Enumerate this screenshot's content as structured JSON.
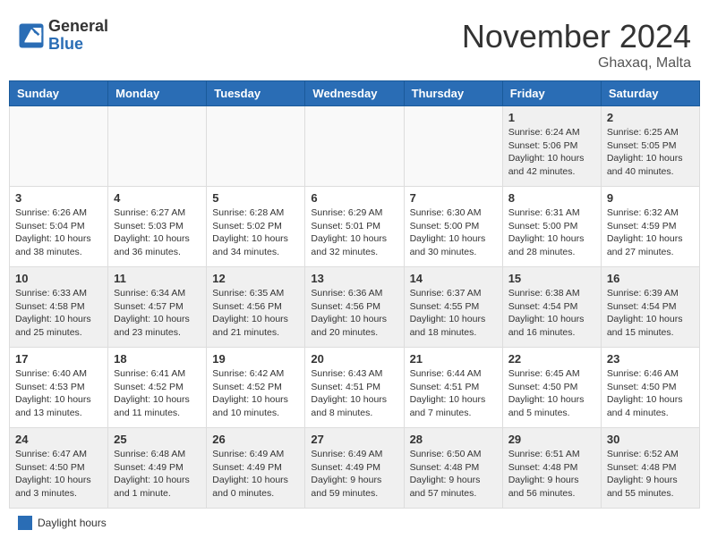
{
  "header": {
    "logo_general": "General",
    "logo_blue": "Blue",
    "month_title": "November 2024",
    "location": "Ghaxaq, Malta"
  },
  "legend": {
    "label": "Daylight hours"
  },
  "days_of_week": [
    "Sunday",
    "Monday",
    "Tuesday",
    "Wednesday",
    "Thursday",
    "Friday",
    "Saturday"
  ],
  "weeks": [
    [
      {
        "day": "",
        "info": ""
      },
      {
        "day": "",
        "info": ""
      },
      {
        "day": "",
        "info": ""
      },
      {
        "day": "",
        "info": ""
      },
      {
        "day": "",
        "info": ""
      },
      {
        "day": "1",
        "info": "Sunrise: 6:24 AM\nSunset: 5:06 PM\nDaylight: 10 hours and 42 minutes."
      },
      {
        "day": "2",
        "info": "Sunrise: 6:25 AM\nSunset: 5:05 PM\nDaylight: 10 hours and 40 minutes."
      }
    ],
    [
      {
        "day": "3",
        "info": "Sunrise: 6:26 AM\nSunset: 5:04 PM\nDaylight: 10 hours and 38 minutes."
      },
      {
        "day": "4",
        "info": "Sunrise: 6:27 AM\nSunset: 5:03 PM\nDaylight: 10 hours and 36 minutes."
      },
      {
        "day": "5",
        "info": "Sunrise: 6:28 AM\nSunset: 5:02 PM\nDaylight: 10 hours and 34 minutes."
      },
      {
        "day": "6",
        "info": "Sunrise: 6:29 AM\nSunset: 5:01 PM\nDaylight: 10 hours and 32 minutes."
      },
      {
        "day": "7",
        "info": "Sunrise: 6:30 AM\nSunset: 5:00 PM\nDaylight: 10 hours and 30 minutes."
      },
      {
        "day": "8",
        "info": "Sunrise: 6:31 AM\nSunset: 5:00 PM\nDaylight: 10 hours and 28 minutes."
      },
      {
        "day": "9",
        "info": "Sunrise: 6:32 AM\nSunset: 4:59 PM\nDaylight: 10 hours and 27 minutes."
      }
    ],
    [
      {
        "day": "10",
        "info": "Sunrise: 6:33 AM\nSunset: 4:58 PM\nDaylight: 10 hours and 25 minutes."
      },
      {
        "day": "11",
        "info": "Sunrise: 6:34 AM\nSunset: 4:57 PM\nDaylight: 10 hours and 23 minutes."
      },
      {
        "day": "12",
        "info": "Sunrise: 6:35 AM\nSunset: 4:56 PM\nDaylight: 10 hours and 21 minutes."
      },
      {
        "day": "13",
        "info": "Sunrise: 6:36 AM\nSunset: 4:56 PM\nDaylight: 10 hours and 20 minutes."
      },
      {
        "day": "14",
        "info": "Sunrise: 6:37 AM\nSunset: 4:55 PM\nDaylight: 10 hours and 18 minutes."
      },
      {
        "day": "15",
        "info": "Sunrise: 6:38 AM\nSunset: 4:54 PM\nDaylight: 10 hours and 16 minutes."
      },
      {
        "day": "16",
        "info": "Sunrise: 6:39 AM\nSunset: 4:54 PM\nDaylight: 10 hours and 15 minutes."
      }
    ],
    [
      {
        "day": "17",
        "info": "Sunrise: 6:40 AM\nSunset: 4:53 PM\nDaylight: 10 hours and 13 minutes."
      },
      {
        "day": "18",
        "info": "Sunrise: 6:41 AM\nSunset: 4:52 PM\nDaylight: 10 hours and 11 minutes."
      },
      {
        "day": "19",
        "info": "Sunrise: 6:42 AM\nSunset: 4:52 PM\nDaylight: 10 hours and 10 minutes."
      },
      {
        "day": "20",
        "info": "Sunrise: 6:43 AM\nSunset: 4:51 PM\nDaylight: 10 hours and 8 minutes."
      },
      {
        "day": "21",
        "info": "Sunrise: 6:44 AM\nSunset: 4:51 PM\nDaylight: 10 hours and 7 minutes."
      },
      {
        "day": "22",
        "info": "Sunrise: 6:45 AM\nSunset: 4:50 PM\nDaylight: 10 hours and 5 minutes."
      },
      {
        "day": "23",
        "info": "Sunrise: 6:46 AM\nSunset: 4:50 PM\nDaylight: 10 hours and 4 minutes."
      }
    ],
    [
      {
        "day": "24",
        "info": "Sunrise: 6:47 AM\nSunset: 4:50 PM\nDaylight: 10 hours and 3 minutes."
      },
      {
        "day": "25",
        "info": "Sunrise: 6:48 AM\nSunset: 4:49 PM\nDaylight: 10 hours and 1 minute."
      },
      {
        "day": "26",
        "info": "Sunrise: 6:49 AM\nSunset: 4:49 PM\nDaylight: 10 hours and 0 minutes."
      },
      {
        "day": "27",
        "info": "Sunrise: 6:49 AM\nSunset: 4:49 PM\nDaylight: 9 hours and 59 minutes."
      },
      {
        "day": "28",
        "info": "Sunrise: 6:50 AM\nSunset: 4:48 PM\nDaylight: 9 hours and 57 minutes."
      },
      {
        "day": "29",
        "info": "Sunrise: 6:51 AM\nSunset: 4:48 PM\nDaylight: 9 hours and 56 minutes."
      },
      {
        "day": "30",
        "info": "Sunrise: 6:52 AM\nSunset: 4:48 PM\nDaylight: 9 hours and 55 minutes."
      }
    ]
  ]
}
